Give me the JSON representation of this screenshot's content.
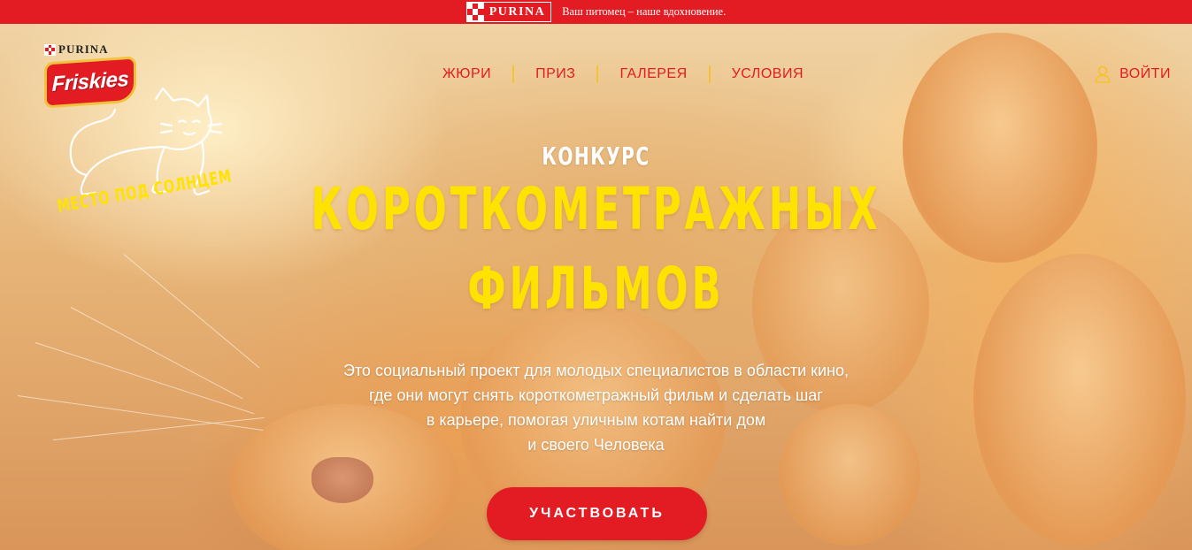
{
  "topbar": {
    "brand": "PURINA",
    "tagline": "Ваш питомец – наше вдохновение."
  },
  "logo": {
    "purina": "PURINA",
    "brand": "Friskies"
  },
  "mascot": {
    "slogan": "МЕСТО ПОД СОЛНЦЕМ"
  },
  "nav": {
    "items": [
      {
        "label": "ЖЮРИ"
      },
      {
        "label": "ПРИЗ"
      },
      {
        "label": "ГАЛЕРЕЯ"
      },
      {
        "label": "УСЛОВИЯ"
      }
    ]
  },
  "login": {
    "label": "ВОЙТИ",
    "icon": "user-icon"
  },
  "hero": {
    "kicker": "КОНКУРС",
    "title_line1": "КОРОТКОМЕТРАЖНЫХ",
    "title_line2": "ФИЛЬМОВ",
    "description": [
      "Это социальный проект для молодых специалистов в области кино,",
      "где они могут снять короткометражный фильм и сделать шаг",
      "в карьере, помогая уличным котам найти дом",
      "и своего Человека"
    ],
    "cta": "УЧАСТВОВАТЬ"
  },
  "colors": {
    "brand_red": "#e31b23",
    "title_yellow": "#ffe300",
    "separator_yellow": "#f3c431"
  }
}
